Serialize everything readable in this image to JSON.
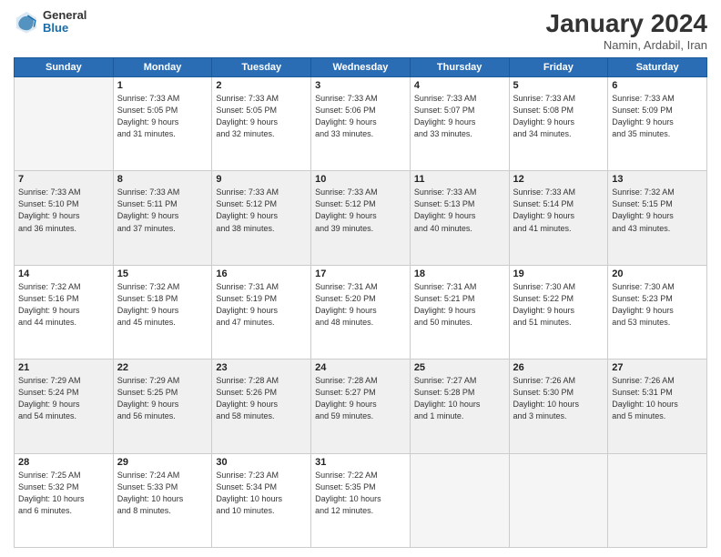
{
  "header": {
    "logo_line1": "General",
    "logo_line2": "Blue",
    "month_year": "January 2024",
    "location": "Namin, Ardabil, Iran"
  },
  "weekdays": [
    "Sunday",
    "Monday",
    "Tuesday",
    "Wednesday",
    "Thursday",
    "Friday",
    "Saturday"
  ],
  "weeks": [
    [
      {
        "day": "",
        "info": ""
      },
      {
        "day": "1",
        "info": "Sunrise: 7:33 AM\nSunset: 5:05 PM\nDaylight: 9 hours\nand 31 minutes."
      },
      {
        "day": "2",
        "info": "Sunrise: 7:33 AM\nSunset: 5:05 PM\nDaylight: 9 hours\nand 32 minutes."
      },
      {
        "day": "3",
        "info": "Sunrise: 7:33 AM\nSunset: 5:06 PM\nDaylight: 9 hours\nand 33 minutes."
      },
      {
        "day": "4",
        "info": "Sunrise: 7:33 AM\nSunset: 5:07 PM\nDaylight: 9 hours\nand 33 minutes."
      },
      {
        "day": "5",
        "info": "Sunrise: 7:33 AM\nSunset: 5:08 PM\nDaylight: 9 hours\nand 34 minutes."
      },
      {
        "day": "6",
        "info": "Sunrise: 7:33 AM\nSunset: 5:09 PM\nDaylight: 9 hours\nand 35 minutes."
      }
    ],
    [
      {
        "day": "7",
        "info": "Sunrise: 7:33 AM\nSunset: 5:10 PM\nDaylight: 9 hours\nand 36 minutes."
      },
      {
        "day": "8",
        "info": "Sunrise: 7:33 AM\nSunset: 5:11 PM\nDaylight: 9 hours\nand 37 minutes."
      },
      {
        "day": "9",
        "info": "Sunrise: 7:33 AM\nSunset: 5:12 PM\nDaylight: 9 hours\nand 38 minutes."
      },
      {
        "day": "10",
        "info": "Sunrise: 7:33 AM\nSunset: 5:12 PM\nDaylight: 9 hours\nand 39 minutes."
      },
      {
        "day": "11",
        "info": "Sunrise: 7:33 AM\nSunset: 5:13 PM\nDaylight: 9 hours\nand 40 minutes."
      },
      {
        "day": "12",
        "info": "Sunrise: 7:33 AM\nSunset: 5:14 PM\nDaylight: 9 hours\nand 41 minutes."
      },
      {
        "day": "13",
        "info": "Sunrise: 7:32 AM\nSunset: 5:15 PM\nDaylight: 9 hours\nand 43 minutes."
      }
    ],
    [
      {
        "day": "14",
        "info": "Sunrise: 7:32 AM\nSunset: 5:16 PM\nDaylight: 9 hours\nand 44 minutes."
      },
      {
        "day": "15",
        "info": "Sunrise: 7:32 AM\nSunset: 5:18 PM\nDaylight: 9 hours\nand 45 minutes."
      },
      {
        "day": "16",
        "info": "Sunrise: 7:31 AM\nSunset: 5:19 PM\nDaylight: 9 hours\nand 47 minutes."
      },
      {
        "day": "17",
        "info": "Sunrise: 7:31 AM\nSunset: 5:20 PM\nDaylight: 9 hours\nand 48 minutes."
      },
      {
        "day": "18",
        "info": "Sunrise: 7:31 AM\nSunset: 5:21 PM\nDaylight: 9 hours\nand 50 minutes."
      },
      {
        "day": "19",
        "info": "Sunrise: 7:30 AM\nSunset: 5:22 PM\nDaylight: 9 hours\nand 51 minutes."
      },
      {
        "day": "20",
        "info": "Sunrise: 7:30 AM\nSunset: 5:23 PM\nDaylight: 9 hours\nand 53 minutes."
      }
    ],
    [
      {
        "day": "21",
        "info": "Sunrise: 7:29 AM\nSunset: 5:24 PM\nDaylight: 9 hours\nand 54 minutes."
      },
      {
        "day": "22",
        "info": "Sunrise: 7:29 AM\nSunset: 5:25 PM\nDaylight: 9 hours\nand 56 minutes."
      },
      {
        "day": "23",
        "info": "Sunrise: 7:28 AM\nSunset: 5:26 PM\nDaylight: 9 hours\nand 58 minutes."
      },
      {
        "day": "24",
        "info": "Sunrise: 7:28 AM\nSunset: 5:27 PM\nDaylight: 9 hours\nand 59 minutes."
      },
      {
        "day": "25",
        "info": "Sunrise: 7:27 AM\nSunset: 5:28 PM\nDaylight: 10 hours\nand 1 minute."
      },
      {
        "day": "26",
        "info": "Sunrise: 7:26 AM\nSunset: 5:30 PM\nDaylight: 10 hours\nand 3 minutes."
      },
      {
        "day": "27",
        "info": "Sunrise: 7:26 AM\nSunset: 5:31 PM\nDaylight: 10 hours\nand 5 minutes."
      }
    ],
    [
      {
        "day": "28",
        "info": "Sunrise: 7:25 AM\nSunset: 5:32 PM\nDaylight: 10 hours\nand 6 minutes."
      },
      {
        "day": "29",
        "info": "Sunrise: 7:24 AM\nSunset: 5:33 PM\nDaylight: 10 hours\nand 8 minutes."
      },
      {
        "day": "30",
        "info": "Sunrise: 7:23 AM\nSunset: 5:34 PM\nDaylight: 10 hours\nand 10 minutes."
      },
      {
        "day": "31",
        "info": "Sunrise: 7:22 AM\nSunset: 5:35 PM\nDaylight: 10 hours\nand 12 minutes."
      },
      {
        "day": "",
        "info": ""
      },
      {
        "day": "",
        "info": ""
      },
      {
        "day": "",
        "info": ""
      }
    ]
  ]
}
